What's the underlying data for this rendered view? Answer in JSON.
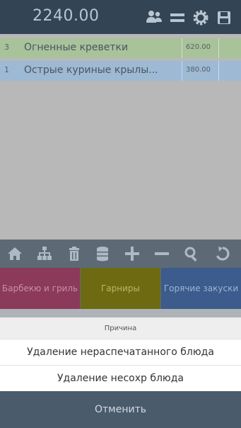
{
  "header": {
    "total": "2240.00",
    "icons": [
      "users-icon",
      "menu-icon",
      "gear-icon",
      "save-icon"
    ]
  },
  "order": {
    "items": [
      {
        "qty": "3",
        "name": "Огненные креветки",
        "price": "620.00",
        "color": "#a8c29a"
      },
      {
        "qty": "1",
        "name": "Острые куриные крылы...",
        "price": "380.00",
        "color": "#9db9d4"
      }
    ]
  },
  "toolbar": {
    "icons": [
      "home-icon",
      "sitemap-icon",
      "trash-icon",
      "database-icon",
      "plus-icon",
      "minus-icon",
      "search-icon",
      "undo-icon"
    ]
  },
  "categories": [
    {
      "label": "Барбекю и гриль",
      "color": "#8b3a5a"
    },
    {
      "label": "Гарниры",
      "color": "#6e6a12"
    },
    {
      "label": "Горячие закуски",
      "color": "#3b5c8c"
    }
  ],
  "sheet": {
    "title": "Причина",
    "options": [
      "Удаление нераспечатанного блюда",
      "Удаление несохр блюда"
    ],
    "cancel": "Отменить"
  }
}
